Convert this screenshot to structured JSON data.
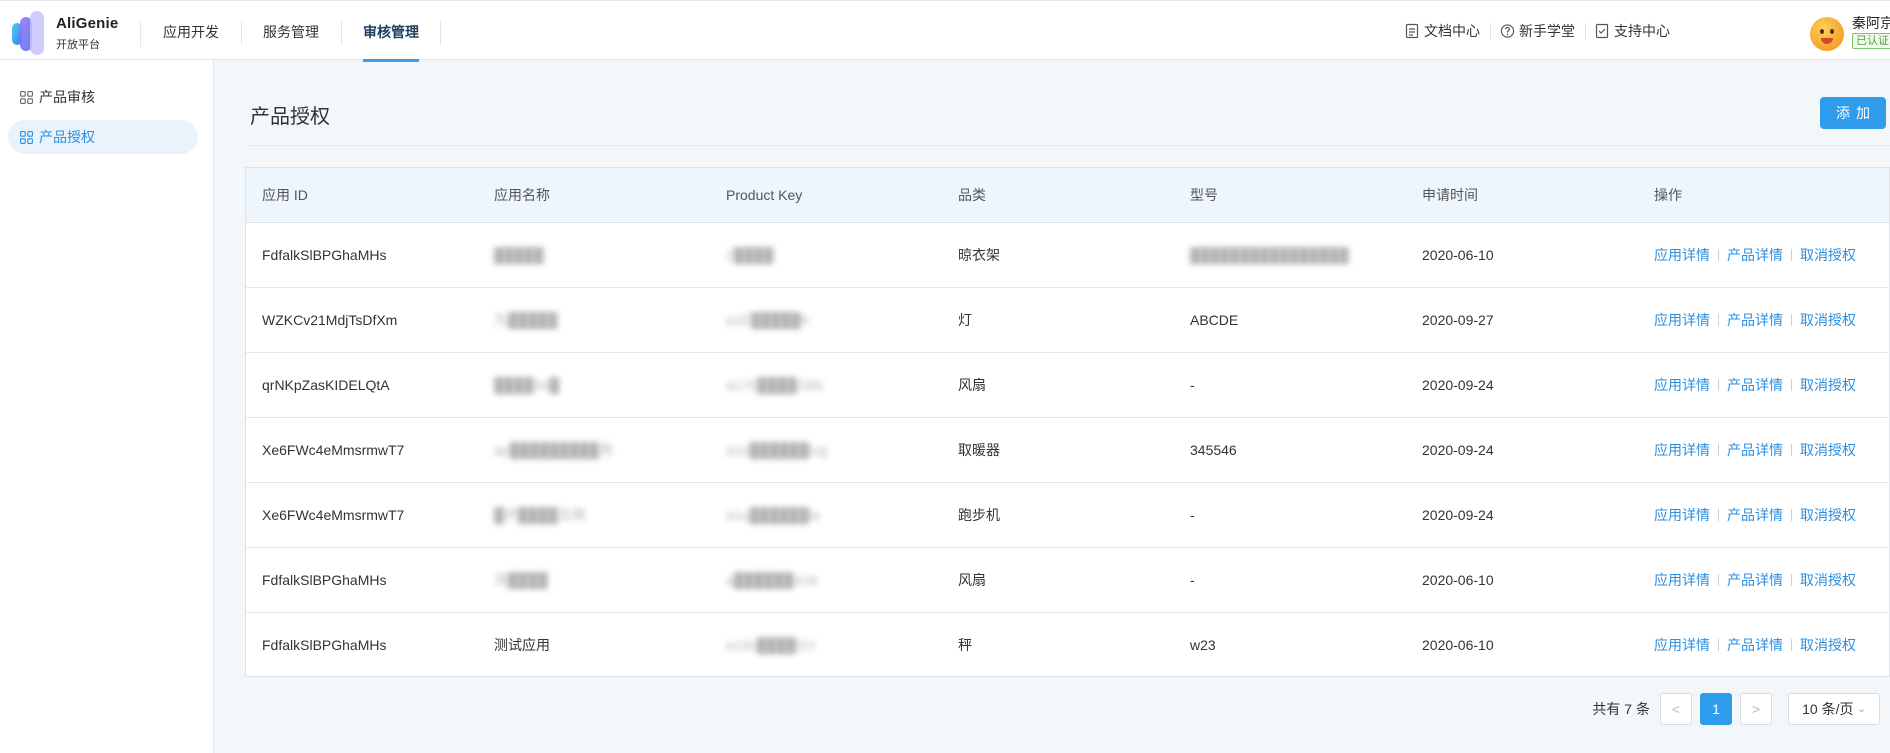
{
  "brand": {
    "name": "AliGenie",
    "subtitle": "开放平台"
  },
  "nav": {
    "items": [
      {
        "label": "应用开发",
        "active": false
      },
      {
        "label": "服务管理",
        "active": false
      },
      {
        "label": "审核管理",
        "active": true
      }
    ]
  },
  "top_links": [
    {
      "label": "文档中心",
      "icon": "document-icon"
    },
    {
      "label": "新手学堂",
      "icon": "help-circle-icon"
    },
    {
      "label": "支持中心",
      "icon": "support-icon"
    }
  ],
  "user": {
    "name": "秦阿京",
    "badge": "已认证"
  },
  "sidebar": {
    "items": [
      {
        "label": "产品审核",
        "active": false
      },
      {
        "label": "产品授权",
        "active": true
      }
    ]
  },
  "page": {
    "title": "产品授权",
    "add_label": "添加"
  },
  "table": {
    "columns": [
      "应用 ID",
      "应用名称",
      "Product Key",
      "品类",
      "型号",
      "申请时间",
      "操作"
    ],
    "rows": [
      {
        "app_id": "FdfalkSlBPGhaMHs",
        "app_name": "█████",
        "product_key": "2████",
        "category": "晾衣架",
        "model": "████████████████",
        "date": "2020-06-10"
      },
      {
        "app_id": "WZKCv21MdjTsDfXm",
        "app_name": "为█████",
        "product_key": "a1E█████K",
        "category": "灯",
        "model": "ABCDE",
        "date": "2020-09-27"
      },
      {
        "app_id": "qrNKpZasKIDELQtA",
        "app_name": "████34█",
        "product_key": "a176████O6b",
        "category": "风扇",
        "model": "-",
        "date": "2020-09-24"
      },
      {
        "app_id": "Xe6FWc4eMmsrmwT7",
        "app_name": "ap█████████用",
        "product_key": "a1n██████lug",
        "category": "取暖器",
        "model": "345546",
        "date": "2020-09-24"
      },
      {
        "app_id": "Xe6FWc4eMmsrmwT7",
        "app_name": "█环████应用",
        "product_key": "a1u██████la",
        "category": "跑步机",
        "model": "-",
        "date": "2020-09-24"
      },
      {
        "app_id": "FdfalkSlBPGhaMHs",
        "app_name": "测████",
        "product_key": "a██████sUe",
        "category": "风扇",
        "model": "-",
        "date": "2020-06-10"
      },
      {
        "app_id": "FdfalkSlBPGhaMHs",
        "app_name": "测试应用",
        "product_key": "a13c████GV",
        "category": "秤",
        "model": "w23",
        "date": "2020-06-10"
      }
    ],
    "actions": [
      "应用详情",
      "产品详情",
      "取消授权"
    ]
  },
  "pagination": {
    "total_text": "共有 7 条",
    "prev": "<",
    "current": "1",
    "next": ">",
    "page_size": "10 条/页"
  },
  "colors": {
    "accent": "#2f9cec",
    "link": "#2b8fe0",
    "header_bg": "#eef6fd"
  }
}
